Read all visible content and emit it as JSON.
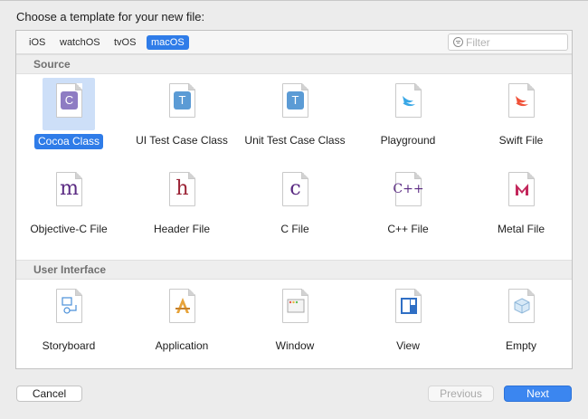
{
  "dialog": {
    "prompt": "Choose a template for your new file:"
  },
  "tabs": [
    {
      "label": "iOS",
      "active": false
    },
    {
      "label": "watchOS",
      "active": false
    },
    {
      "label": "tvOS",
      "active": false
    },
    {
      "label": "macOS",
      "active": true
    }
  ],
  "filter": {
    "placeholder": "Filter",
    "value": ""
  },
  "sections": [
    {
      "title": "Source",
      "items": [
        {
          "label": "Cocoa Class",
          "icon": "cocoa-class-icon",
          "glyph": "C",
          "selected": true
        },
        {
          "label": "UI Test Case Class",
          "icon": "ui-test-case-icon",
          "glyph": "T",
          "selected": false
        },
        {
          "label": "Unit Test Case Class",
          "icon": "unit-test-case-icon",
          "glyph": "T",
          "selected": false
        },
        {
          "label": "Playground",
          "icon": "playground-icon",
          "glyph": "",
          "selected": false
        },
        {
          "label": "Swift File",
          "icon": "swift-file-icon",
          "glyph": "",
          "selected": false
        },
        {
          "label": "Objective-C File",
          "icon": "objective-c-icon",
          "glyph": "m",
          "selected": false
        },
        {
          "label": "Header File",
          "icon": "header-file-icon",
          "glyph": "h",
          "selected": false
        },
        {
          "label": "C File",
          "icon": "c-file-icon",
          "glyph": "c",
          "selected": false
        },
        {
          "label": "C++ File",
          "icon": "cpp-file-icon",
          "glyph": "C++",
          "selected": false
        },
        {
          "label": "Metal File",
          "icon": "metal-file-icon",
          "glyph": "",
          "selected": false
        }
      ]
    },
    {
      "title": "User Interface",
      "items": [
        {
          "label": "Storyboard",
          "icon": "storyboard-icon",
          "glyph": "",
          "selected": false
        },
        {
          "label": "Application",
          "icon": "application-icon",
          "glyph": "",
          "selected": false
        },
        {
          "label": "Window",
          "icon": "window-icon",
          "glyph": "",
          "selected": false
        },
        {
          "label": "View",
          "icon": "view-icon",
          "glyph": "",
          "selected": false
        },
        {
          "label": "Empty",
          "icon": "empty-icon",
          "glyph": "",
          "selected": false
        }
      ]
    }
  ],
  "buttons": {
    "cancel": "Cancel",
    "previous": "Previous",
    "next": "Next"
  },
  "colors": {
    "accent": "#2f7ce8",
    "selection_bg": "#cddff8",
    "class_purple": "#8e7cc3",
    "test_blue": "#5b9bd5",
    "file_purple": "#5a2a82",
    "header_red": "#9b2335",
    "swift_orange": "#f05138"
  }
}
